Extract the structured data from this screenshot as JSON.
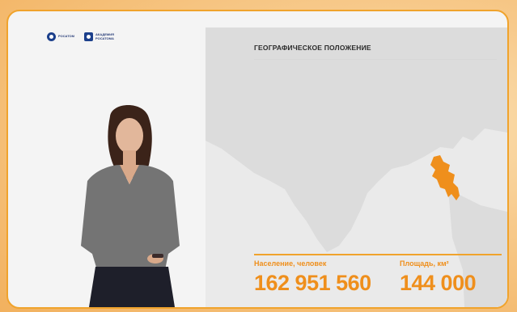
{
  "logos": {
    "primary_text": "РОСАТОМ",
    "secondary_text": "АКАДЕМИЯ РОСАТОМА"
  },
  "slide": {
    "heading": "ГЕОГРАФИЧЕСКОЕ ПОЛОЖЕНИЕ"
  },
  "stats": {
    "population_label": "Население, человек",
    "population_value": "162 951 560",
    "area_label": "Площадь, км²",
    "area_value": "144 000"
  },
  "colors": {
    "accent": "#ef8f1c",
    "frame": "#f0a32c",
    "map_land": "#d9d9d9",
    "map_highlight": "#ef8f1c"
  },
  "icons": {
    "highlight": "bangladesh-map-highlight"
  }
}
